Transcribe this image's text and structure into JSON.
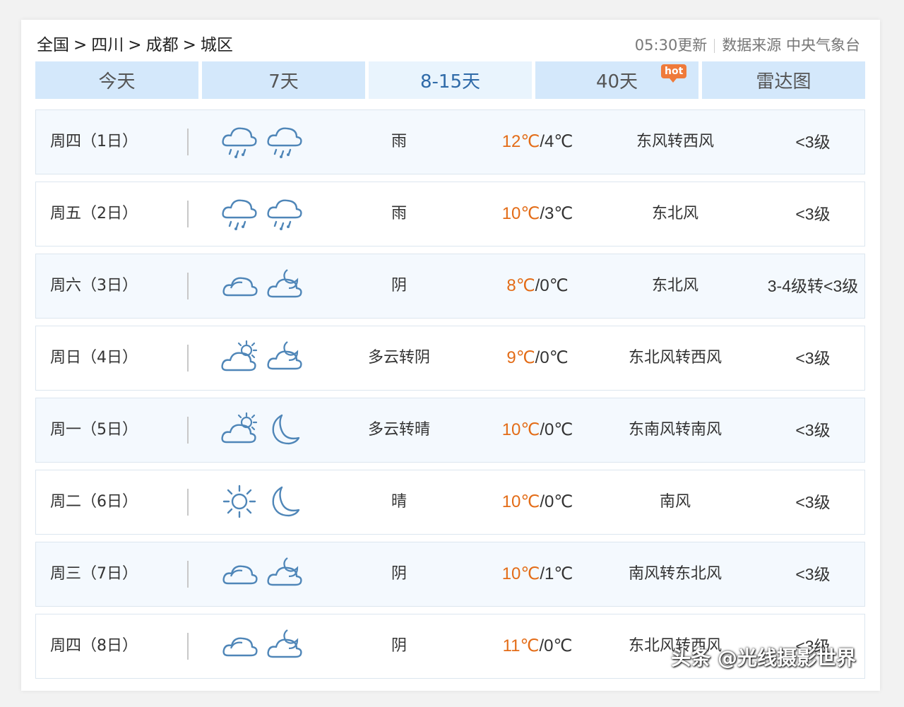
{
  "breadcrumb": {
    "items": [
      "全国",
      "四川",
      "成都",
      "城区"
    ],
    "separator": ">"
  },
  "meta": {
    "update_time": "05:30更新",
    "source": "数据来源 中央气象台"
  },
  "tabs": [
    {
      "label": "今天",
      "active": false
    },
    {
      "label": "7天",
      "active": false
    },
    {
      "label": "8-15天",
      "active": true
    },
    {
      "label": "40天",
      "active": false,
      "badge": "hot"
    },
    {
      "label": "雷达图",
      "active": false
    }
  ],
  "colors": {
    "high_temp": "#e36c17",
    "tab_bg": "#d4e8fb",
    "tab_active_text": "#2f6aa8",
    "icon_stroke": "#4f86b8"
  },
  "forecast": [
    {
      "date": "周四（1日）",
      "day_icon": "rain-icon",
      "night_icon": "rain-icon",
      "weather": "雨",
      "high": "12℃",
      "low": "/4℃",
      "wind": "东风转西风",
      "level": "<3级"
    },
    {
      "date": "周五（2日）",
      "day_icon": "rain-icon",
      "night_icon": "rain-icon",
      "weather": "雨",
      "high": "10℃",
      "low": "/3℃",
      "wind": "东北风",
      "level": "<3级"
    },
    {
      "date": "周六（3日）",
      "day_icon": "overcast-icon",
      "night_icon": "cloudy-night-icon",
      "weather": "阴",
      "high": "8℃",
      "low": "/0℃",
      "wind": "东北风",
      "level": "3-4级转<3级"
    },
    {
      "date": "周日（4日）",
      "day_icon": "partly-cloudy-day-icon",
      "night_icon": "cloudy-night-icon",
      "weather": "多云转阴",
      "high": "9℃",
      "low": "/0℃",
      "wind": "东北风转西风",
      "level": "<3级"
    },
    {
      "date": "周一（5日）",
      "day_icon": "partly-cloudy-day-icon",
      "night_icon": "moon-icon",
      "weather": "多云转晴",
      "high": "10℃",
      "low": "/0℃",
      "wind": "东南风转南风",
      "level": "<3级"
    },
    {
      "date": "周二（6日）",
      "day_icon": "sun-icon",
      "night_icon": "moon-icon",
      "weather": "晴",
      "high": "10℃",
      "low": "/0℃",
      "wind": "南风",
      "level": "<3级"
    },
    {
      "date": "周三（7日）",
      "day_icon": "overcast-icon",
      "night_icon": "cloudy-night-icon",
      "weather": "阴",
      "high": "10℃",
      "low": "/1℃",
      "wind": "南风转东北风",
      "level": "<3级"
    },
    {
      "date": "周四（8日）",
      "day_icon": "overcast-icon",
      "night_icon": "cloudy-night-icon",
      "weather": "阴",
      "high": "11℃",
      "low": "/0℃",
      "wind": "东北风转西风",
      "level": "<3级"
    }
  ],
  "watermark": "头条 @光线摄影世界"
}
